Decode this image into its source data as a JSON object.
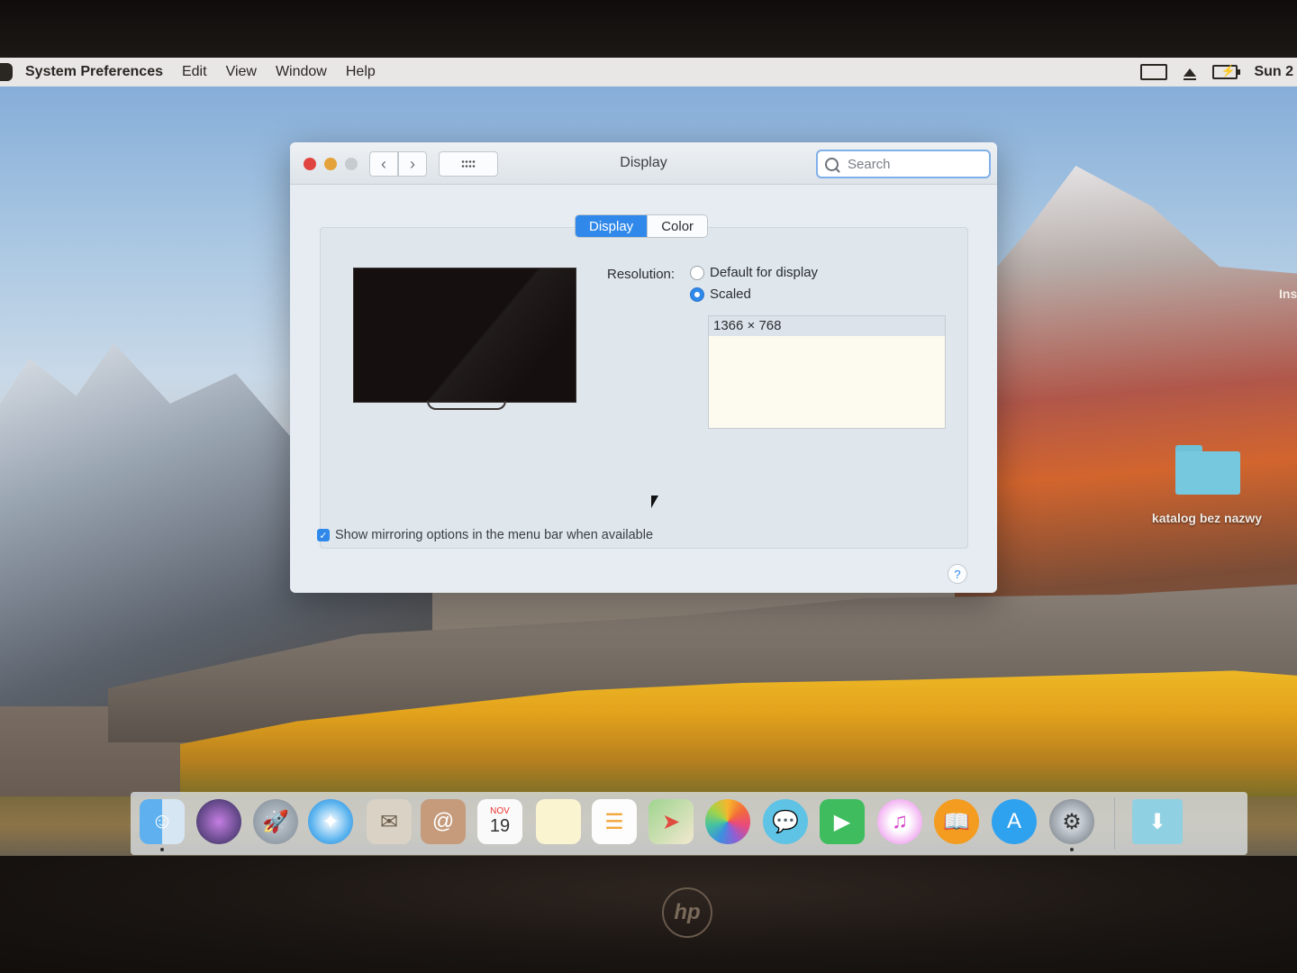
{
  "menubar": {
    "app_name": "System Preferences",
    "items": [
      "Edit",
      "View",
      "Window",
      "Help"
    ],
    "clock": "Sun 2"
  },
  "window": {
    "title": "Display",
    "search_placeholder": "Search",
    "tabs": [
      {
        "label": "Display",
        "active": true
      },
      {
        "label": "Color",
        "active": false
      }
    ],
    "resolution": {
      "label": "Resolution:",
      "options": [
        {
          "label": "Default for display",
          "selected": false
        },
        {
          "label": "Scaled",
          "selected": true
        }
      ],
      "scaled_list": [
        "1366 × 768"
      ]
    },
    "mirroring_checkbox": {
      "label": "Show mirroring options in the menu bar when available",
      "checked": true
    },
    "help_label": "?"
  },
  "desktop": {
    "folder_label": "katalog bez nazwy",
    "edge_label": "Ins"
  },
  "dock": {
    "apps": [
      "finder-icon",
      "siri-icon",
      "launchpad-icon",
      "safari-icon",
      "mail-icon",
      "contacts-icon",
      "calendar-icon",
      "notes-icon",
      "reminders-icon",
      "maps-icon",
      "photos-icon",
      "messages-icon",
      "facetime-icon",
      "itunes-icon",
      "ibooks-icon",
      "app-store-icon",
      "system-preferences-icon",
      "downloads-icon"
    ],
    "calendar": {
      "month": "NOV",
      "day": "19"
    }
  },
  "colors": {
    "accent": "#2f88ea",
    "close": "#e0443e",
    "minimize": "#e3a23a"
  }
}
